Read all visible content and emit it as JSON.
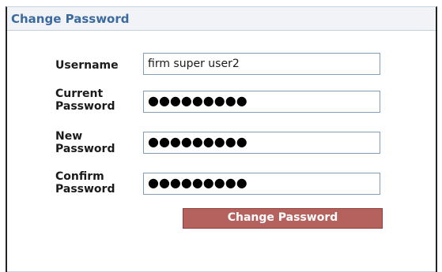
{
  "panel": {
    "title": "Change Password"
  },
  "form": {
    "username": {
      "label": "Username",
      "value": "firm super user2"
    },
    "current_password": {
      "label": "Current\nPassword",
      "value": "●●●●●●●●●"
    },
    "new_password": {
      "label": "New\nPassword",
      "value": "●●●●●●●●●"
    },
    "confirm_password": {
      "label": "Confirm\nPassword",
      "value": "●●●●●●●●●"
    },
    "submit_label": "Change Password"
  },
  "colors": {
    "title": "#3a6a9f",
    "button": "#b5625f",
    "field_border": "#7f9db9"
  }
}
